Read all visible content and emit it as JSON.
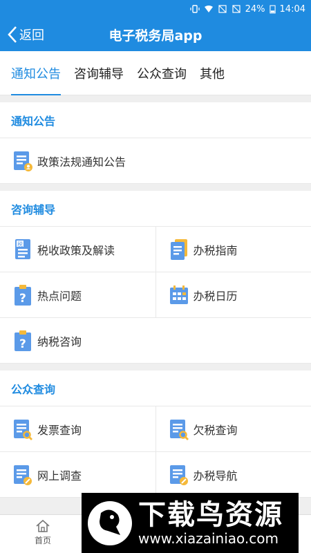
{
  "status": {
    "battery": "24%",
    "time": "14:04"
  },
  "appbar": {
    "back_label": "返回",
    "title": "电子税务局app"
  },
  "tabs": [
    {
      "label": "通知公告",
      "active": true
    },
    {
      "label": "咨询辅导",
      "active": false
    },
    {
      "label": "公众查询",
      "active": false
    },
    {
      "label": "其他",
      "active": false
    }
  ],
  "sections": {
    "notice": {
      "title": "通知公告",
      "items": {
        "policy": "政策法规通知公告"
      }
    },
    "consult": {
      "title": "咨询辅导",
      "items": {
        "tax_policy": "税收政策及解读",
        "tax_guide": "办税指南",
        "hot_issues": "热点问题",
        "tax_calendar": "办税日历",
        "tax_consult": "纳税咨询"
      }
    },
    "public": {
      "title": "公众查询",
      "items": {
        "invoice": "发票查询",
        "arrears": "欠税查询",
        "survey": "网上调查",
        "tax_nav": "办税导航"
      }
    }
  },
  "bottom_nav": {
    "home_label": "首页"
  },
  "watermark": {
    "cn": "下载鸟资源",
    "url": "www.xiazainiao.com"
  },
  "colors": {
    "brand": "#1f8be0",
    "icon_blue": "#5b9ae8",
    "icon_orange": "#f5b93a"
  },
  "icons": {
    "doc_person": "document-person-icon",
    "tax_doc": "tax-document-icon",
    "guide": "guide-book-icon",
    "clipboard_q": "clipboard-question-icon",
    "calendar": "calendar-icon",
    "doc_search": "document-search-icon",
    "doc_edit": "document-edit-icon"
  }
}
